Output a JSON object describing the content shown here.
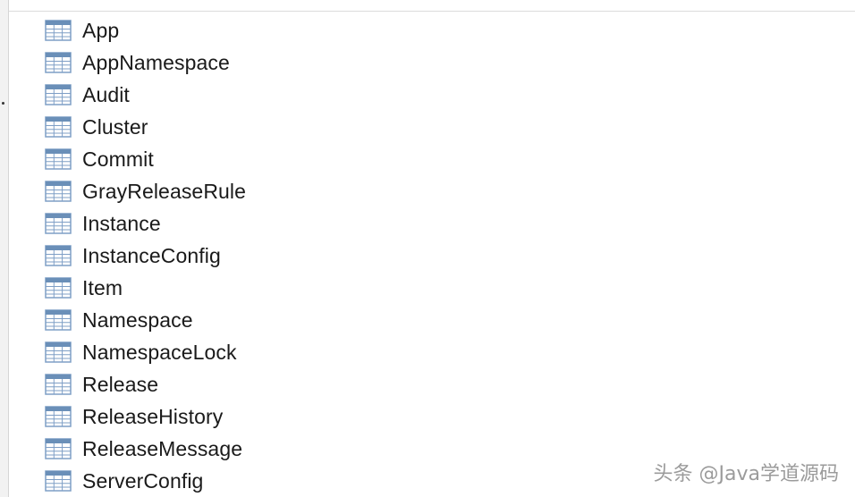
{
  "tables": [
    {
      "name": "App",
      "icon": "table-icon"
    },
    {
      "name": "AppNamespace",
      "icon": "table-icon"
    },
    {
      "name": "Audit",
      "icon": "table-icon"
    },
    {
      "name": "Cluster",
      "icon": "table-icon"
    },
    {
      "name": "Commit",
      "icon": "table-icon"
    },
    {
      "name": "GrayReleaseRule",
      "icon": "table-icon"
    },
    {
      "name": "Instance",
      "icon": "table-icon"
    },
    {
      "name": "InstanceConfig",
      "icon": "table-icon"
    },
    {
      "name": "Item",
      "icon": "table-icon"
    },
    {
      "name": "Namespace",
      "icon": "table-icon"
    },
    {
      "name": "NamespaceLock",
      "icon": "table-icon"
    },
    {
      "name": "Release",
      "icon": "table-icon"
    },
    {
      "name": "ReleaseHistory",
      "icon": "table-icon"
    },
    {
      "name": "ReleaseMessage",
      "icon": "table-icon"
    },
    {
      "name": "ServerConfig",
      "icon": "table-icon"
    }
  ],
  "watermark": "头条 @Java学道源码",
  "colors": {
    "icon_header": "#6a8fb8",
    "icon_grid": "#7f9fc6",
    "icon_cell": "#ffffff",
    "text": "#1a1a1a"
  }
}
